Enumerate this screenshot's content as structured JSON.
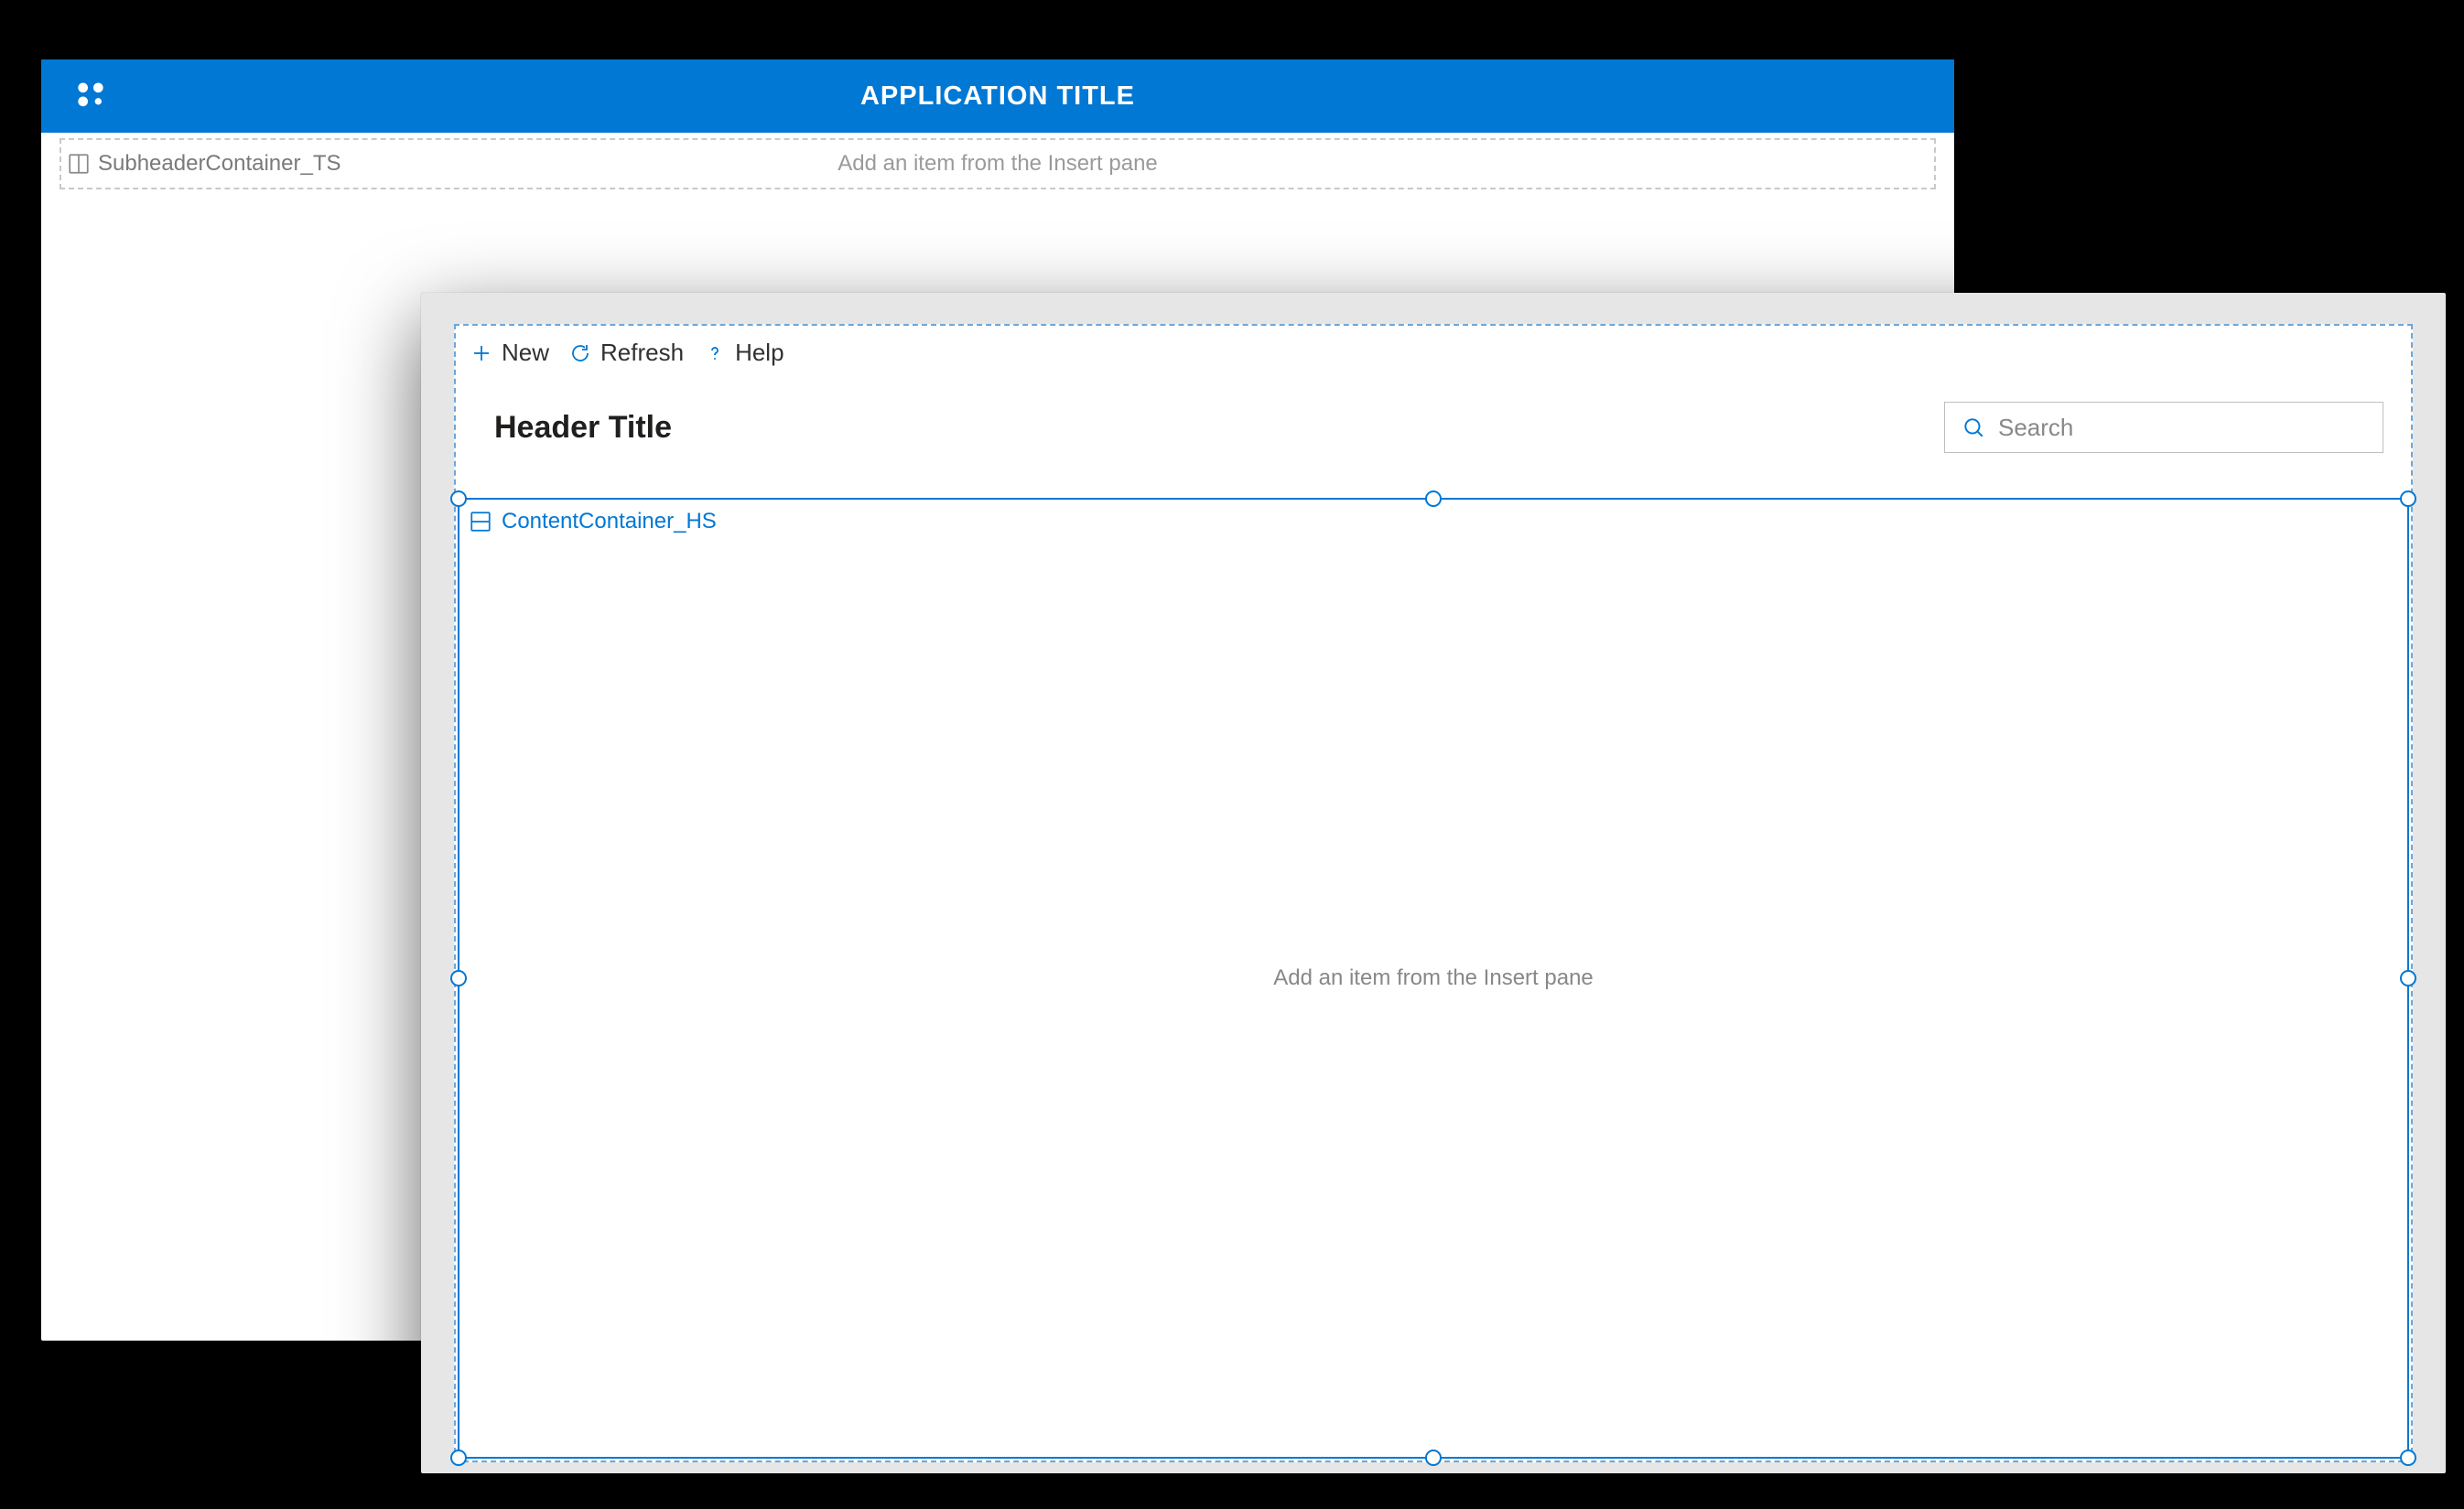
{
  "colors": {
    "primary": "#0078d4",
    "dashedGray": "#c9c9c9",
    "textMuted": "#8a8886"
  },
  "backWindow": {
    "appTitle": "APPLICATION TITLE",
    "subheader": {
      "controlName": "SubheaderContainer_TS",
      "hint": "Add an item from the Insert pane"
    }
  },
  "frontWindow": {
    "commandBar": {
      "new": "New",
      "refresh": "Refresh",
      "help": "Help"
    },
    "headerTitle": "Header Title",
    "search": {
      "placeholder": "Search",
      "value": ""
    },
    "contentContainer": {
      "controlName": "ContentContainer_HS",
      "hint": "Add an item from the Insert pane"
    }
  }
}
